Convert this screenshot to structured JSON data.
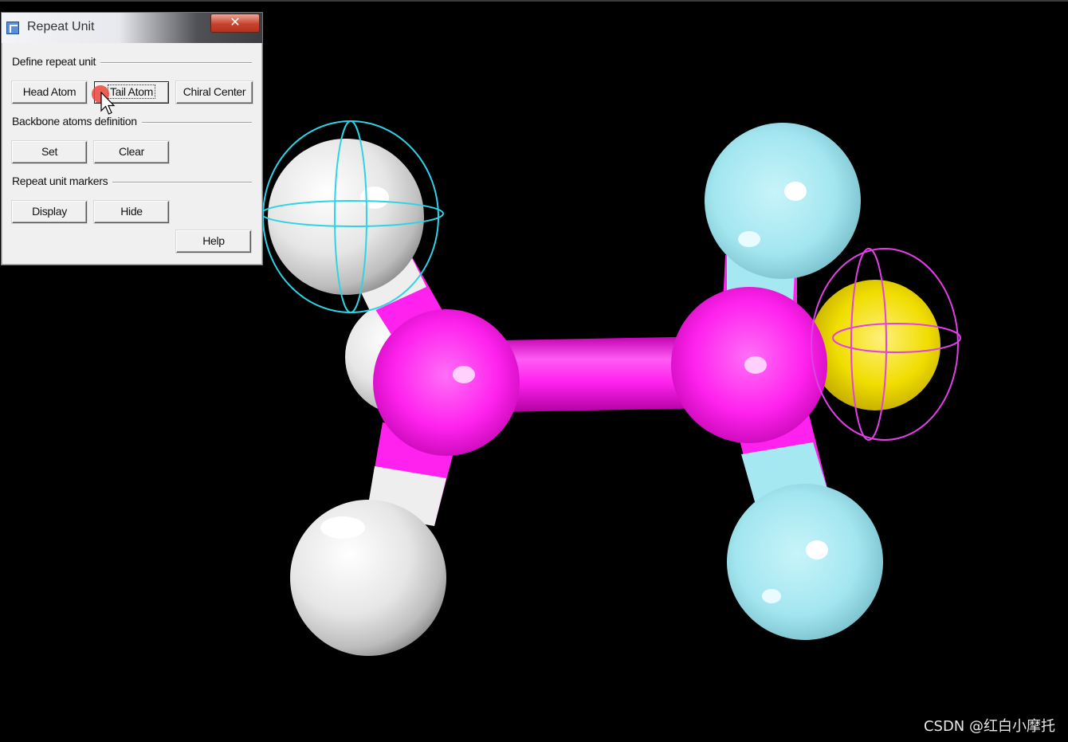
{
  "dialog": {
    "title": "Repeat Unit",
    "close_label": "✕",
    "groups": {
      "define": "Define repeat unit",
      "backbone": "Backbone atoms definition",
      "markers": "Repeat unit markers"
    },
    "buttons": {
      "head_atom": "Head Atom",
      "tail_atom": "Tail Atom",
      "chiral_center": "Chiral Center",
      "set": "Set",
      "clear": "Clear",
      "display": "Display",
      "hide": "Hide",
      "help": "Help"
    }
  },
  "viewport": {
    "background": "#000000",
    "atom_colors": {
      "carbon": "#ff22ee",
      "hydrogen": "#f2f2f2",
      "fluorine": "#a6e8f2",
      "sulfur": "#f0dd00"
    },
    "marker_colors": {
      "head": "#2fd3e6",
      "tail": "#e040e6"
    }
  },
  "watermark": "CSDN @红白小摩托"
}
